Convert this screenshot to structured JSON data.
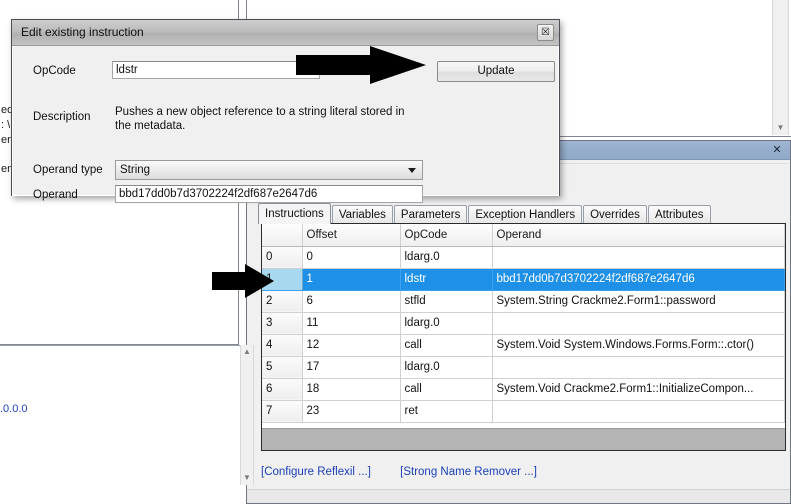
{
  "dialog": {
    "title": "Edit existing instruction",
    "close_label": "☒",
    "fields": {
      "opcode_label": "OpCode",
      "opcode_value": "ldstr",
      "description_label": "Description",
      "description_value": "Pushes a new object reference to a string literal stored in the metadata.",
      "operand_type_label": "Operand type",
      "operand_type_value": "String",
      "operand_label": "Operand",
      "operand_value": "bbd17dd0b7d3702224f2df687e2647d6"
    },
    "update_button": "Update"
  },
  "host": {
    "close_label": "✕"
  },
  "tabs": [
    {
      "label": "Instructions",
      "active": true
    },
    {
      "label": "Variables",
      "active": false
    },
    {
      "label": "Parameters",
      "active": false
    },
    {
      "label": "Exception Handlers",
      "active": false
    },
    {
      "label": "Overrides",
      "active": false
    },
    {
      "label": "Attributes",
      "active": false
    }
  ],
  "grid": {
    "columns": [
      "",
      "Offset",
      "OpCode",
      "Operand"
    ],
    "rows": [
      {
        "index": "0",
        "offset": "0",
        "opcode": "ldarg.0",
        "operand": "",
        "selected": false
      },
      {
        "index": "1",
        "offset": "1",
        "opcode": "ldstr",
        "operand": "bbd17dd0b7d3702224f2df687e2647d6",
        "selected": true
      },
      {
        "index": "2",
        "offset": "6",
        "opcode": "stfld",
        "operand": "System.String Crackme2.Form1::password",
        "selected": false
      },
      {
        "index": "3",
        "offset": "11",
        "opcode": "ldarg.0",
        "operand": "",
        "selected": false
      },
      {
        "index": "4",
        "offset": "12",
        "opcode": "call",
        "operand": "System.Void System.Windows.Forms.Form::.ctor()",
        "selected": false
      },
      {
        "index": "5",
        "offset": "17",
        "opcode": "ldarg.0",
        "operand": "",
        "selected": false
      },
      {
        "index": "6",
        "offset": "18",
        "opcode": "call",
        "operand": "System.Void Crackme2.Form1::InitializeCompon...",
        "selected": false
      },
      {
        "index": "7",
        "offset": "23",
        "opcode": "ret",
        "operand": "",
        "selected": false
      }
    ]
  },
  "links": {
    "configure": "[Configure Reflexil ...]",
    "strong_name": "[Strong Name Remover ...]"
  },
  "background_fragments": {
    "frag1": "ed",
    "frag2": ": \\",
    "frag3": "ent",
    "frag4": "ent",
    "version": ".0.0.0"
  },
  "scrollbar": {
    "up_arrow": "▲",
    "down_arrow": "▼"
  },
  "colors": {
    "selection_blue": "#1e90e8",
    "rowheader_blue": "#a8d8f0",
    "link_blue": "#1b3fb5",
    "host_titlebar": "#95aecb",
    "annotation_arrow": "#000000"
  }
}
